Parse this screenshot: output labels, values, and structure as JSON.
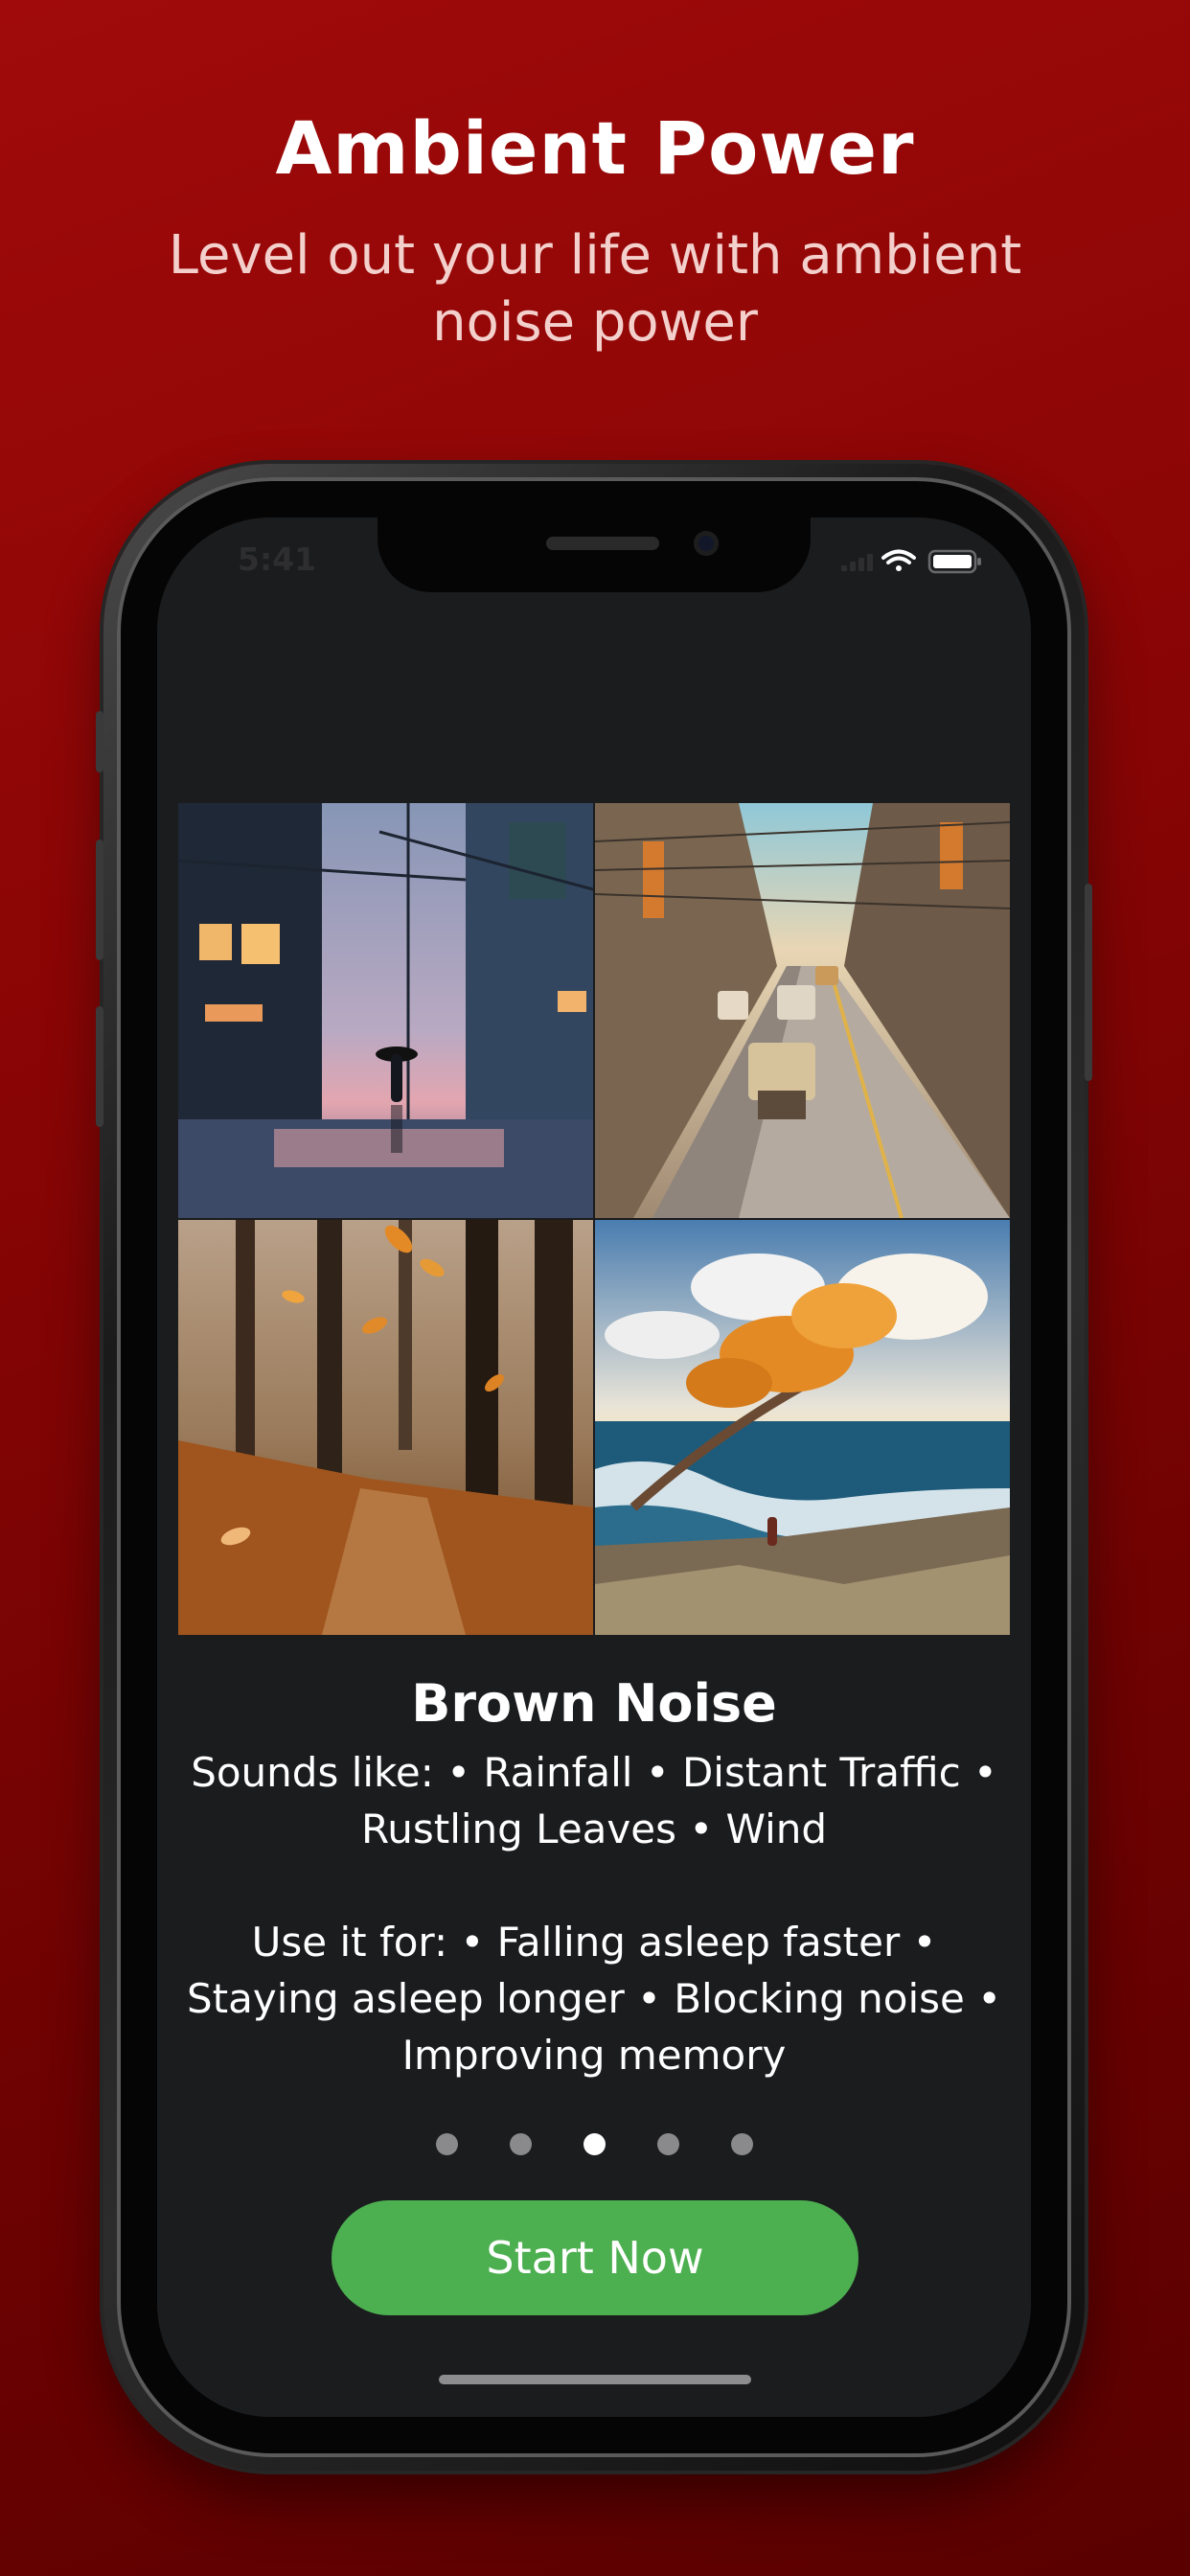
{
  "promo": {
    "headline": "Ambient Power",
    "subheadline": "Level out your life with ambient noise power"
  },
  "status_bar": {
    "time": "5:41",
    "icons": [
      "wifi-icon",
      "battery-icon"
    ]
  },
  "onboarding": {
    "images": [
      {
        "name": "rain-street-image"
      },
      {
        "name": "traffic-street-image"
      },
      {
        "name": "autumn-forest-image"
      },
      {
        "name": "windy-coast-image"
      }
    ],
    "title": "Brown Noise",
    "sounds_like": "Sounds like: • Rainfall • Distant Traffic • Rustling Leaves • Wind",
    "use_it_for": "Use it for: • Falling asleep faster • Staying asleep longer • Blocking noise • Improving memory",
    "page_count": 5,
    "current_page": 3,
    "cta_label": "Start Now"
  },
  "colors": {
    "background": "#8a0505",
    "screen": "#1b1c1e",
    "cta": "#4caf50",
    "dot_active": "#ffffff",
    "dot_inactive": "#8a8a8c"
  }
}
